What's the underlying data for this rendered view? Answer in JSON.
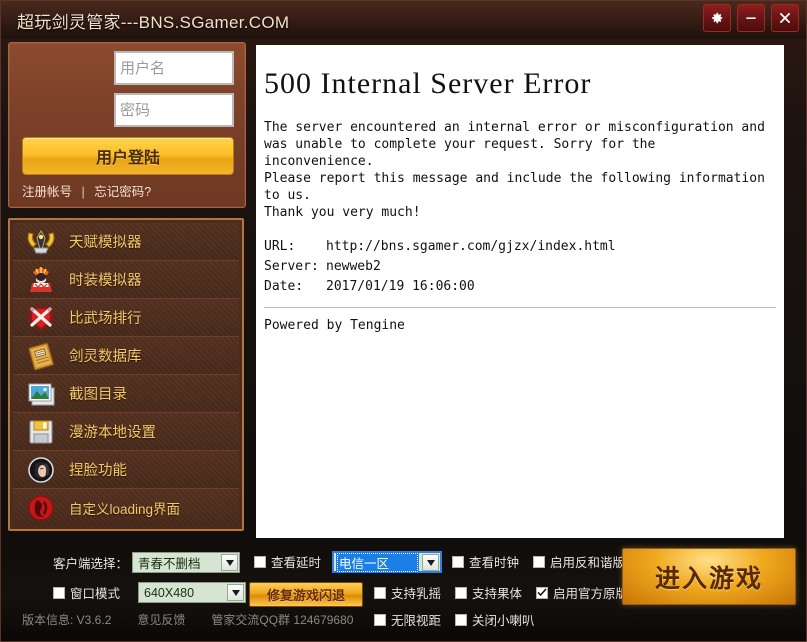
{
  "window": {
    "title": "超玩剑灵管家---BNS.SGamer.COM",
    "buttons": [
      {
        "name": "settings",
        "icon": "gear-icon"
      },
      {
        "name": "minimize",
        "icon": "minimize-icon"
      },
      {
        "name": "close",
        "icon": "close-icon"
      }
    ]
  },
  "login": {
    "username_placeholder": "用户名",
    "username_value": "",
    "password_placeholder": "密码",
    "password_value": "",
    "submit_label": "用户登陆",
    "register_label": "注册帐号",
    "separator": "|",
    "forgot_label": "忘记密码?"
  },
  "menu": {
    "items": [
      {
        "label": "天赋模拟器",
        "icon": "talent-simulator-icon"
      },
      {
        "label": "时装模拟器",
        "icon": "costume-simulator-icon"
      },
      {
        "label": "比武场排行",
        "icon": "arena-ranking-icon"
      },
      {
        "label": "剑灵数据库",
        "icon": "database-book-icon"
      },
      {
        "label": "截图目录",
        "icon": "screenshot-folder-icon"
      },
      {
        "label": "漫游本地设置",
        "icon": "floppy-save-icon"
      },
      {
        "label": "捏脸功能",
        "icon": "face-customize-icon"
      },
      {
        "label": "自定义loading界面",
        "icon": "custom-loading-icon"
      }
    ]
  },
  "content": {
    "title": "500 Internal Server Error",
    "body": "The server encountered an internal error or misconfiguration and\nwas unable to complete your request. Sorry for the\ninconvenience.\nPlease report this message and include the following information\nto us.\nThank you very much!",
    "meta": [
      {
        "key": "URL:",
        "value": "http://bns.sgamer.com/gjzx/index.html"
      },
      {
        "key": "Server:",
        "value": "newweb2"
      },
      {
        "key": "Date:",
        "value": "2017/01/19 16:06:00"
      }
    ],
    "footer": "Powered by Tengine"
  },
  "bottom": {
    "client_label": "客户端选择：",
    "client_value": "青春不删档",
    "server_value": "电信一区",
    "window_mode_label": "窗口模式",
    "window_mode_checked": false,
    "resolution_value": "640X480",
    "fix_crash_label": "修复游戏闪退",
    "checks_row1": [
      {
        "label": "查看延时",
        "checked": false
      },
      {
        "label": "查看时钟",
        "checked": false
      },
      {
        "label": "启用反和谐版",
        "checked": false
      }
    ],
    "checks_row2": [
      {
        "label": "支持乳摇",
        "checked": false
      },
      {
        "label": "支持果体",
        "checked": false
      },
      {
        "label": "启用官方原版",
        "checked": true
      }
    ],
    "checks_row3": [
      {
        "label": "无限视距",
        "checked": false
      },
      {
        "label": "关闭小喇叭",
        "checked": false
      }
    ],
    "version_label": "版本信息: V3.6.2",
    "feedback_label": "意见反馈",
    "qq_label": "管家交流QQ群 124679680",
    "play_label": "进入游戏"
  }
}
